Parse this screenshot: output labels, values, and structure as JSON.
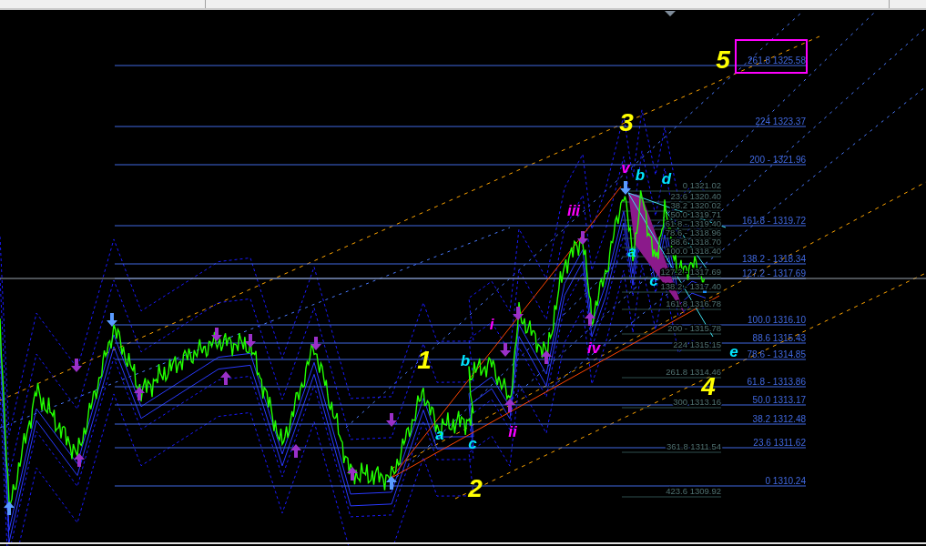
{
  "fib_levels_primary": [
    {
      "label": "261.8 1325.58",
      "highlighted": true
    },
    {
      "label": "224 1323.37",
      "highlighted": false
    },
    {
      "label": "200 - 1321.96",
      "highlighted": false
    },
    {
      "label": "161.8 - 1319.72",
      "highlighted": false
    },
    {
      "label": "138.2 - 1318.34",
      "highlighted": false
    },
    {
      "label": "127.2 - 1317.69",
      "highlighted": false
    },
    {
      "label": "100.0 1316.10",
      "highlighted": false
    },
    {
      "label": "88.6 1315.43",
      "highlighted": false
    },
    {
      "label": "78.6 - 1314.85",
      "highlighted": false
    },
    {
      "label": "61.8 - 1313.86",
      "highlighted": false
    },
    {
      "label": "50.0 1313.17",
      "highlighted": false
    },
    {
      "label": "38.2 1312.48",
      "highlighted": false
    },
    {
      "label": "23.6 1311.62",
      "highlighted": false
    },
    {
      "label": "0 1310.24",
      "highlighted": false
    }
  ],
  "fib_levels_secondary": [
    {
      "label": "0 1321.02"
    },
    {
      "label": "23.6 1320.40"
    },
    {
      "label": "38.2 1320.02"
    },
    {
      "label": "50.0 1319.71"
    },
    {
      "label": "61.8 - 1319.40"
    },
    {
      "label": "78.6 - 1318.96"
    },
    {
      "label": "88.6 1318.70"
    },
    {
      "label": "100.0 1318.40"
    },
    {
      "label": "127.2 - 1317.69"
    },
    {
      "label": "138.2 - 1317.40"
    },
    {
      "label": "161.8 1316.78"
    },
    {
      "label": "200 - 1315.78"
    },
    {
      "label": "224 1315.15"
    },
    {
      "label": "261.8 1314.46"
    },
    {
      "label": "300 1313.16"
    },
    {
      "label": "361.8 1311.54"
    },
    {
      "label": "423.6 1309.92"
    }
  ],
  "wave_labels": [
    {
      "text": "5",
      "kind": "impulse"
    },
    {
      "text": "3",
      "kind": "impulse"
    },
    {
      "text": "1",
      "kind": "impulse"
    },
    {
      "text": "2",
      "kind": "impulse"
    },
    {
      "text": "4",
      "kind": "impulse"
    },
    {
      "text": "v",
      "kind": "minor"
    },
    {
      "text": "iii",
      "kind": "minor"
    },
    {
      "text": "i",
      "kind": "minor"
    },
    {
      "text": "ii",
      "kind": "minor"
    },
    {
      "text": "iv",
      "kind": "minor"
    },
    {
      "text": "b",
      "kind": "corrective"
    },
    {
      "text": "d",
      "kind": "corrective"
    },
    {
      "text": "a",
      "kind": "corrective"
    },
    {
      "text": "c",
      "kind": "corrective"
    },
    {
      "text": "e",
      "kind": "corrective"
    },
    {
      "text": "a",
      "kind": "corrective"
    },
    {
      "text": "b",
      "kind": "corrective"
    },
    {
      "text": "c",
      "kind": "corrective"
    }
  ]
}
